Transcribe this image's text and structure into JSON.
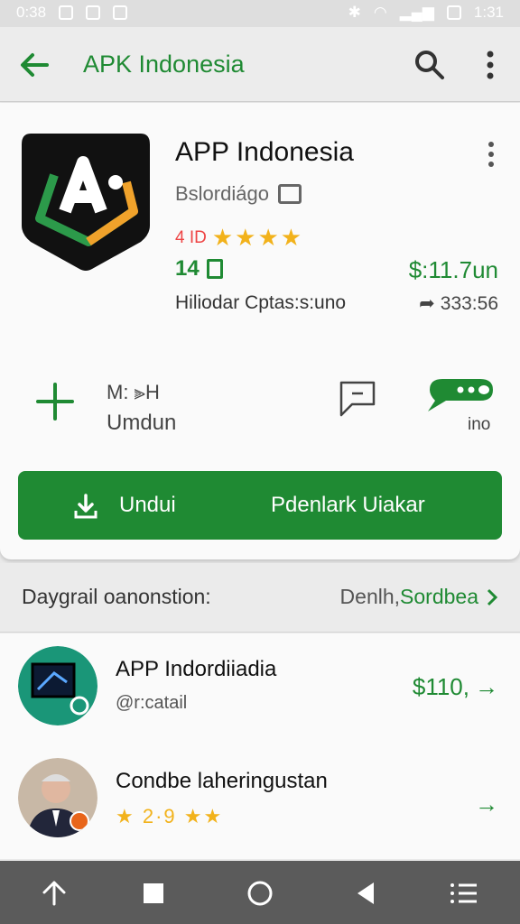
{
  "status_bar": {
    "time": "0:38",
    "right_time": "1:31"
  },
  "app_bar": {
    "title": "APK Indonesia"
  },
  "app": {
    "name": "APP Indonesia",
    "developer": "Bslordiágo",
    "rating_text": "4 ID",
    "stars": "★★★★",
    "size": "14",
    "price": "$:11.7un",
    "options_text": "Hiliodar Cptas:s:uno",
    "downloads": "333:56"
  },
  "actions": {
    "secondary_top": "M: ⫸H",
    "secondary_label": "Umdun",
    "message_label": "ino",
    "download_label": "Undui",
    "download_subtitle": "Pdenlark Uiakar"
  },
  "section": {
    "title": "Daygrail oanonstion:",
    "link_prefix": "Denlh,",
    "link_green": "Sordbea"
  },
  "list": [
    {
      "title": "APP Indordiiadia",
      "subtitle": "@r:catail",
      "price": "$110,",
      "arrow": "→"
    },
    {
      "title": "Condbe laheringustan",
      "stars_label": "★ 2·9 ★★",
      "arrow": "→"
    }
  ],
  "colors": {
    "accent": "#1f8a33",
    "star": "#f2b21b",
    "navbar": "#5b5b5b"
  }
}
